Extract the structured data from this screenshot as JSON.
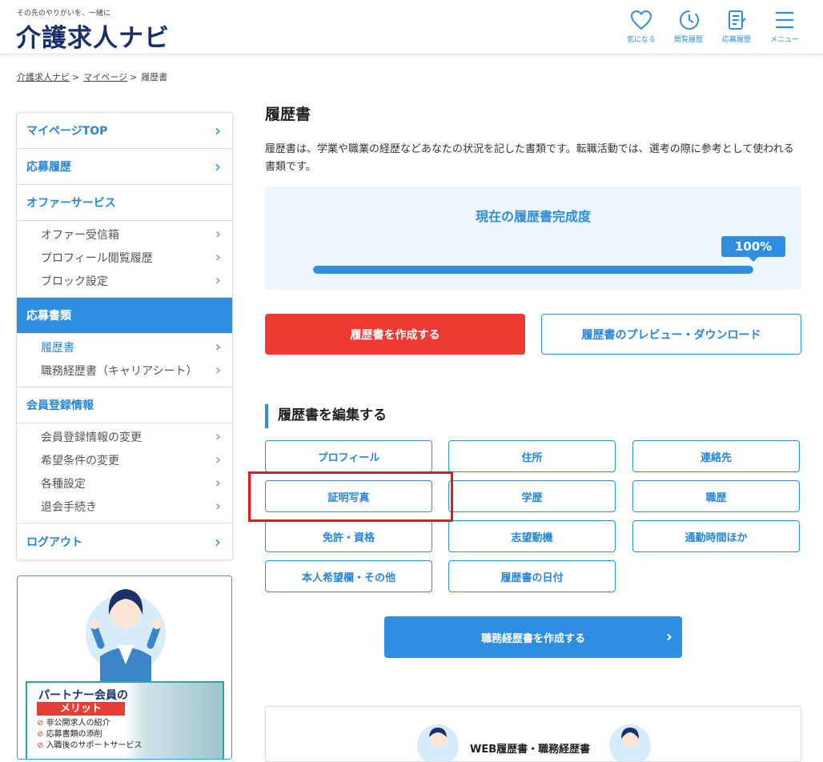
{
  "header": {
    "tagline": "その先のやりがいを、一緒に",
    "logo": "介護求人ナビ",
    "nav": [
      {
        "label": "気になる",
        "icon": "heart-icon"
      },
      {
        "label": "閲覧履歴",
        "icon": "history-clock-icon"
      },
      {
        "label": "応募履歴",
        "icon": "application-document-icon"
      },
      {
        "label": "メニュー",
        "icon": "hamburger-menu-icon"
      }
    ]
  },
  "breadcrumb": {
    "items": [
      "介護求人ナビ",
      "マイページ",
      "履歴書"
    ],
    "sep": ">"
  },
  "sidebar": {
    "mypage_top": "マイページTOP",
    "applications": "応募履歴",
    "offer": {
      "label": "オファーサービス",
      "items": [
        "オファー受信箱",
        "プロフィール閲覧履歴",
        "ブロック設定"
      ]
    },
    "docs": {
      "label": "応募書類",
      "items": [
        "履歴書",
        "職務経歴書（キャリアシート）"
      ]
    },
    "member": {
      "label": "会員登録情報",
      "items": [
        "会員登録情報の変更",
        "希望条件の変更",
        "各種設定",
        "退会手続き"
      ]
    },
    "logout": "ログアウト",
    "chevron": "›"
  },
  "banner": {
    "title": "パートナー会員の",
    "merit": "メリット",
    "points": [
      "非公開求人の紹介",
      "応募書類の添削",
      "入職後のサポートサービス"
    ]
  },
  "main": {
    "title": "履歴書",
    "description": "履歴書は、学業や職業の経歴などあなたの状況を記した書類です。転職活動では、選考の際に参考として使われる書類です。",
    "progress": {
      "title": "現在の履歴書完成度",
      "label": "100%",
      "value": 100
    },
    "create_button": "履歴書を作成する",
    "preview_button": "履歴書のプレビュー・ダウンロード",
    "edit_heading": "履歴書を編集する",
    "edit_buttons": [
      "プロフィール",
      "住所",
      "連絡先",
      "証明写真",
      "学歴",
      "職歴",
      "免許・資格",
      "志望動機",
      "通勤時間ほか",
      "本人希望欄・その他",
      "履歴書の日付"
    ],
    "career_button": "職務経歴書を作成する",
    "career_chevron": "›",
    "bottom_card_text": "WEB履歴書・職務経歴書"
  },
  "colors": {
    "accent": "#2f8ee0",
    "primary_red": "#ee3a33",
    "logo_navy": "#1b2f6b",
    "highlight": "#e3181d"
  }
}
